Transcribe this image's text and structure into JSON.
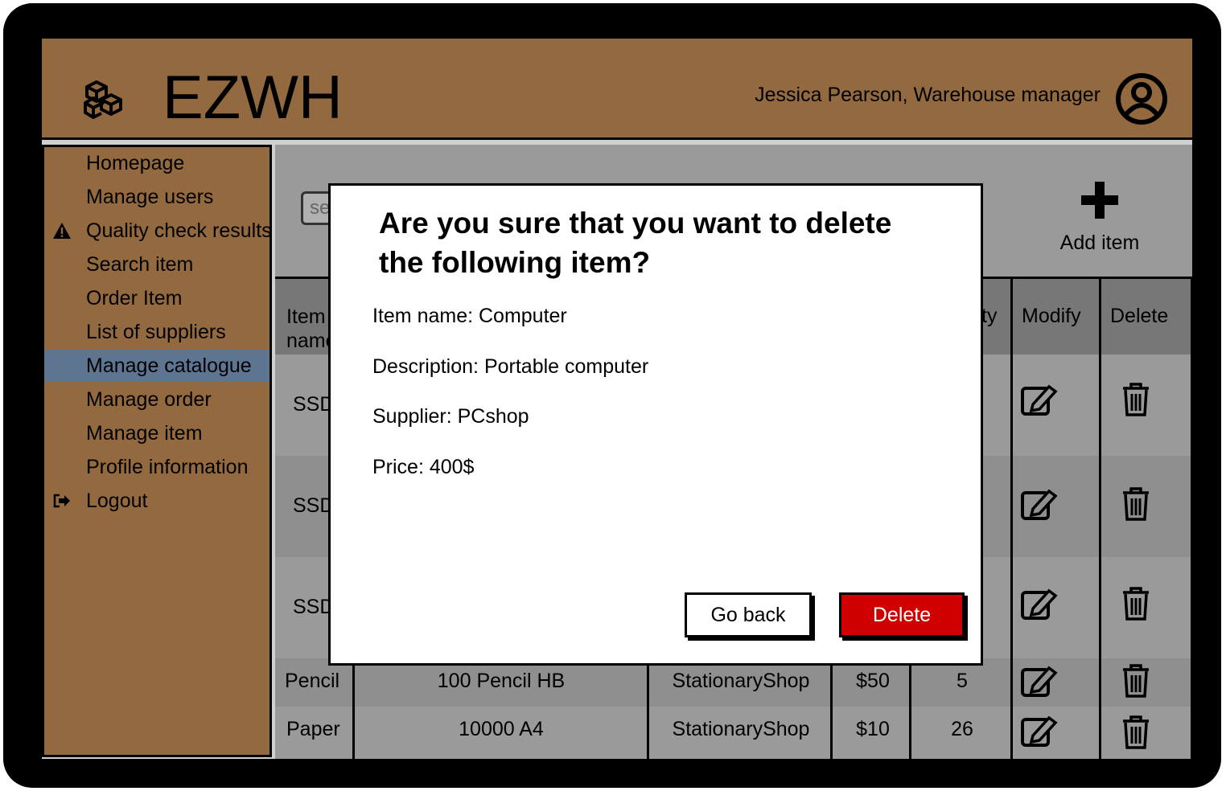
{
  "header": {
    "app_title": "EZWH",
    "user_name": "Jessica Pearson, Warehouse manager"
  },
  "sidebar": {
    "items": [
      {
        "label": "Homepage"
      },
      {
        "label": "Manage users"
      },
      {
        "label": "Quality check results",
        "icon": "warning-icon"
      },
      {
        "label": "Search item"
      },
      {
        "label": "Order Item"
      },
      {
        "label": "List of suppliers"
      },
      {
        "label": "Manage catalogue",
        "active": true
      },
      {
        "label": "Manage order"
      },
      {
        "label": "Manage item"
      },
      {
        "label": "Profile information"
      },
      {
        "label": "Logout",
        "icon": "logout-icon"
      }
    ]
  },
  "toolbar": {
    "search_placeholder": "se",
    "add_item_label": "Add item"
  },
  "table": {
    "headers": {
      "item_name": "Item name",
      "quantity_partial": "ty",
      "modify": "Modify",
      "delete": "Delete"
    },
    "rows": [
      {
        "name": "SSD",
        "description": "",
        "supplier": "",
        "price": "",
        "quantity": ""
      },
      {
        "name": "SSD",
        "description": "",
        "supplier": "",
        "price": "",
        "quantity": ""
      },
      {
        "name": "SSD",
        "description": "",
        "supplier": "",
        "price": "",
        "quantity": ""
      },
      {
        "name": "Pencil",
        "description": "100 Pencil HB",
        "supplier": "StationaryShop",
        "price": "$50",
        "quantity": "5"
      },
      {
        "name": "Paper",
        "description": "10000 A4",
        "supplier": "StationaryShop",
        "price": "$10",
        "quantity": "26"
      }
    ]
  },
  "modal": {
    "title": "Are you sure that you want to delete the following item?",
    "item_name": "Item name: Computer",
    "description": "Description: Portable computer",
    "supplier": "Supplier: PCshop",
    "price": "Price: 400$",
    "go_back_label": "Go back",
    "delete_label": "Delete"
  },
  "colors": {
    "header_bg": "#936940",
    "sidebar_active": "#5e7591",
    "delete_button": "#d00000",
    "content_bg": "#9a9a9a"
  }
}
